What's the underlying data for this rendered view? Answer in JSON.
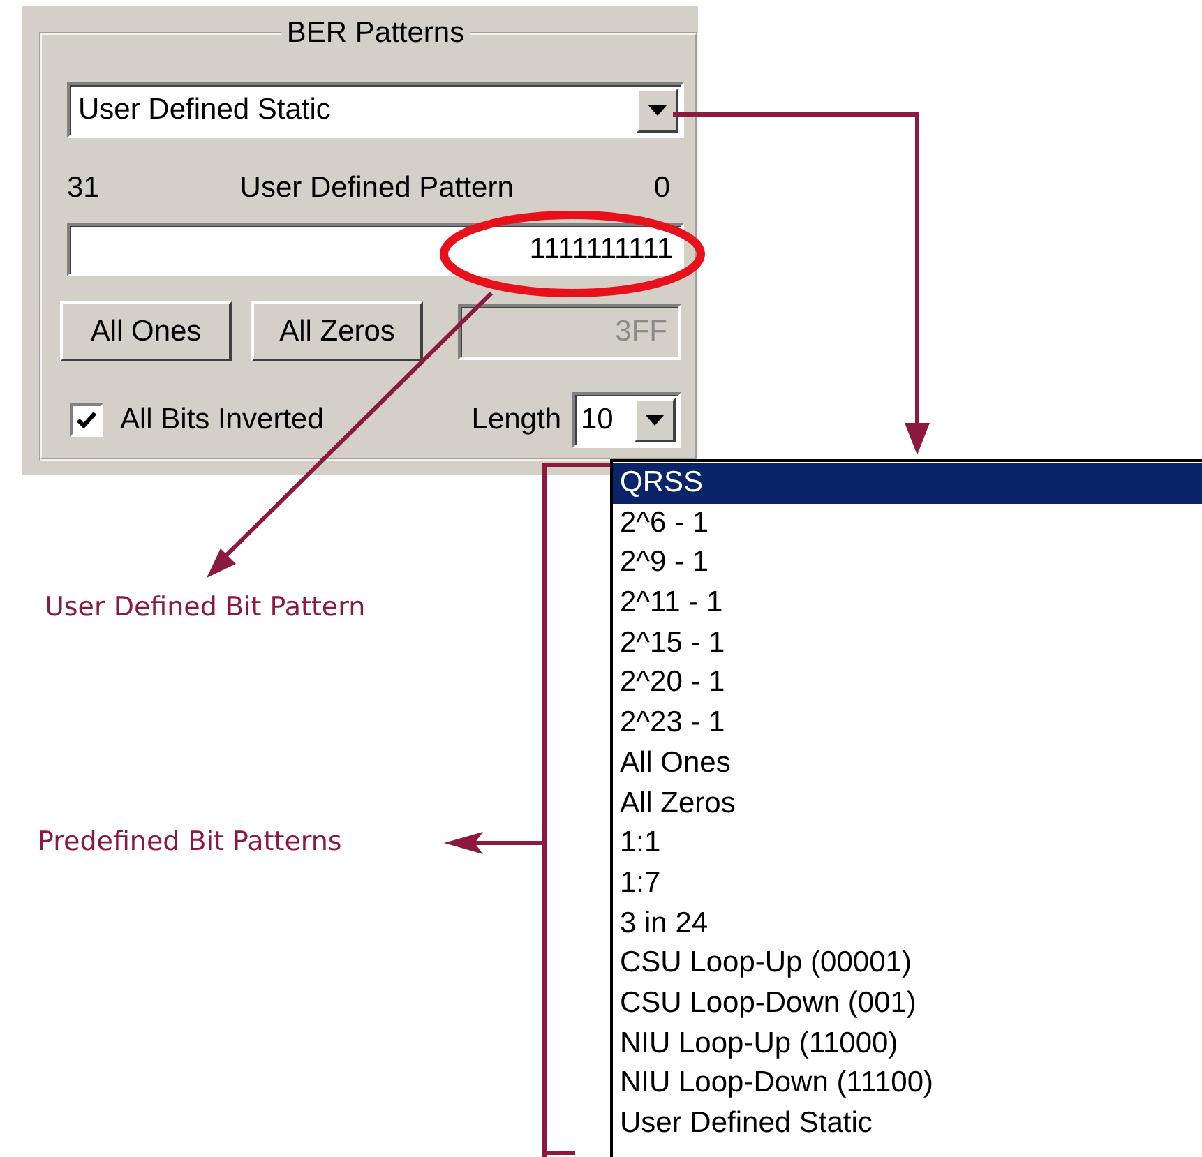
{
  "group_box": {
    "title": "BER Patterns"
  },
  "pattern_select": {
    "value": "User Defined Static"
  },
  "pattern_labels": {
    "high_bit": "31",
    "title": "User Defined Pattern",
    "low_bit": "0"
  },
  "pattern_field": {
    "value": "1111111111"
  },
  "buttons": [
    "All Ones",
    "All Zeros"
  ],
  "hex_field": {
    "value": "3FF",
    "disabled": true
  },
  "invert_checkbox": {
    "label": "All Bits Inverted",
    "checked": true
  },
  "length": {
    "label": "Length",
    "value": "10"
  },
  "dropdown_list": {
    "items": [
      {
        "label": "QRSS",
        "selected": true
      },
      {
        "label": "2^6 - 1",
        "selected": false
      },
      {
        "label": "2^9 - 1",
        "selected": false
      },
      {
        "label": "2^11 - 1",
        "selected": false
      },
      {
        "label": "2^15 - 1",
        "selected": false
      },
      {
        "label": "2^20 - 1",
        "selected": false
      },
      {
        "label": "2^23 - 1",
        "selected": false
      },
      {
        "label": "All Ones",
        "selected": false
      },
      {
        "label": "All Zeros",
        "selected": false
      },
      {
        "label": "1:1",
        "selected": false
      },
      {
        "label": "1:7",
        "selected": false
      },
      {
        "label": "3 in 24",
        "selected": false
      },
      {
        "label": "CSU Loop-Up (00001)",
        "selected": false
      },
      {
        "label": "CSU Loop-Down (001)",
        "selected": false
      },
      {
        "label": "NIU Loop-Up (11000)",
        "selected": false
      },
      {
        "label": "NIU Loop-Down (11100)",
        "selected": false
      },
      {
        "label": "User Defined Static",
        "selected": false
      }
    ]
  },
  "callouts": [
    {
      "text": "User Defined Bit Pattern"
    },
    {
      "text": "Predefined Bit Patterns"
    }
  ]
}
